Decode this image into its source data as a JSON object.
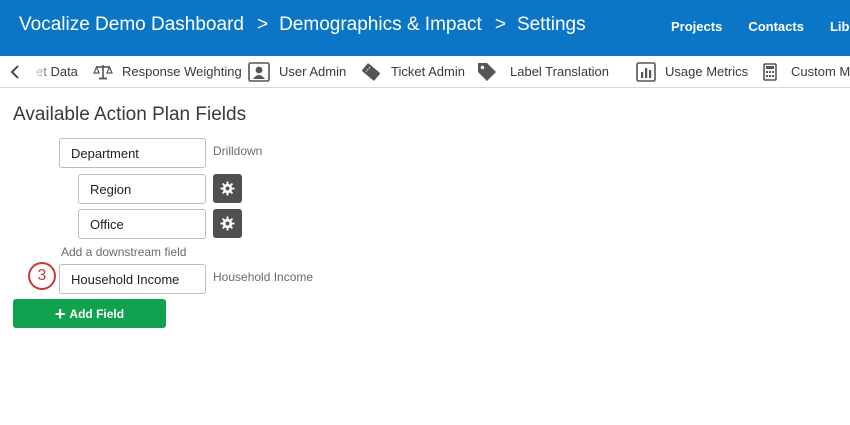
{
  "header": {
    "breadcrumbs": [
      "Vocalize Demo Dashboard",
      "Demographics & Impact",
      "Settings"
    ],
    "separator": ">",
    "nav": [
      "Projects",
      "Contacts",
      "Library"
    ]
  },
  "toolbar": {
    "items": [
      {
        "label": "et Data",
        "icon": "dataset-icon"
      },
      {
        "label": "Response Weighting",
        "icon": "scale-icon"
      },
      {
        "label": "User Admin",
        "icon": "user-card-icon"
      },
      {
        "label": "Ticket Admin",
        "icon": "ticket-icon"
      },
      {
        "label": "Label Translation",
        "icon": "tag-icon"
      },
      {
        "label": "Usage Metrics",
        "icon": "bar-chart-icon"
      },
      {
        "label": "Custom Me",
        "icon": "calculator-icon"
      }
    ]
  },
  "main": {
    "title": "Available Action Plan Fields",
    "fields": [
      {
        "value": "Department",
        "description": "Drilldown"
      },
      {
        "value": "Region"
      },
      {
        "value": "Office"
      }
    ],
    "downstream_label": "Add a downstream field",
    "downstream_field": {
      "value": "Household Income",
      "description": "Household Income"
    },
    "step_number": "3",
    "add_button_label": "Add Field"
  },
  "colors": {
    "header_bg": "#0b76c5",
    "add_button": "#12a14f",
    "step_badge": "#c8373a",
    "gear_button": "#4f4f4f"
  }
}
